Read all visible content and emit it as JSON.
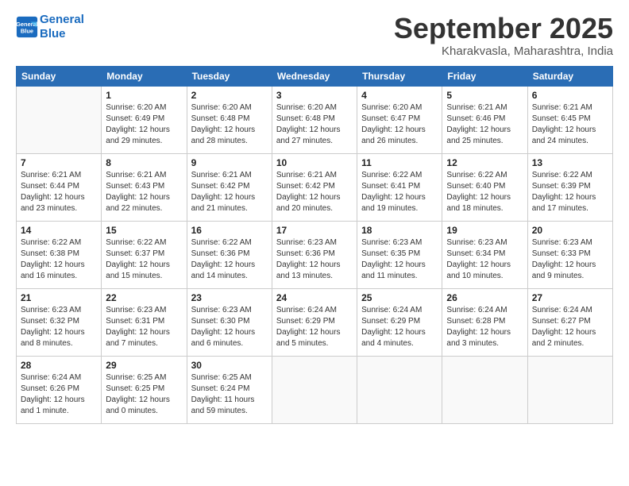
{
  "logo": {
    "line1": "General",
    "line2": "Blue"
  },
  "title": "September 2025",
  "location": "Kharakvasla, Maharashtra, India",
  "days_header": [
    "Sunday",
    "Monday",
    "Tuesday",
    "Wednesday",
    "Thursday",
    "Friday",
    "Saturday"
  ],
  "weeks": [
    [
      {
        "day": "",
        "info": ""
      },
      {
        "day": "1",
        "info": "Sunrise: 6:20 AM\nSunset: 6:49 PM\nDaylight: 12 hours\nand 29 minutes."
      },
      {
        "day": "2",
        "info": "Sunrise: 6:20 AM\nSunset: 6:48 PM\nDaylight: 12 hours\nand 28 minutes."
      },
      {
        "day": "3",
        "info": "Sunrise: 6:20 AM\nSunset: 6:48 PM\nDaylight: 12 hours\nand 27 minutes."
      },
      {
        "day": "4",
        "info": "Sunrise: 6:20 AM\nSunset: 6:47 PM\nDaylight: 12 hours\nand 26 minutes."
      },
      {
        "day": "5",
        "info": "Sunrise: 6:21 AM\nSunset: 6:46 PM\nDaylight: 12 hours\nand 25 minutes."
      },
      {
        "day": "6",
        "info": "Sunrise: 6:21 AM\nSunset: 6:45 PM\nDaylight: 12 hours\nand 24 minutes."
      }
    ],
    [
      {
        "day": "7",
        "info": "Sunrise: 6:21 AM\nSunset: 6:44 PM\nDaylight: 12 hours\nand 23 minutes."
      },
      {
        "day": "8",
        "info": "Sunrise: 6:21 AM\nSunset: 6:43 PM\nDaylight: 12 hours\nand 22 minutes."
      },
      {
        "day": "9",
        "info": "Sunrise: 6:21 AM\nSunset: 6:42 PM\nDaylight: 12 hours\nand 21 minutes."
      },
      {
        "day": "10",
        "info": "Sunrise: 6:21 AM\nSunset: 6:42 PM\nDaylight: 12 hours\nand 20 minutes."
      },
      {
        "day": "11",
        "info": "Sunrise: 6:22 AM\nSunset: 6:41 PM\nDaylight: 12 hours\nand 19 minutes."
      },
      {
        "day": "12",
        "info": "Sunrise: 6:22 AM\nSunset: 6:40 PM\nDaylight: 12 hours\nand 18 minutes."
      },
      {
        "day": "13",
        "info": "Sunrise: 6:22 AM\nSunset: 6:39 PM\nDaylight: 12 hours\nand 17 minutes."
      }
    ],
    [
      {
        "day": "14",
        "info": "Sunrise: 6:22 AM\nSunset: 6:38 PM\nDaylight: 12 hours\nand 16 minutes."
      },
      {
        "day": "15",
        "info": "Sunrise: 6:22 AM\nSunset: 6:37 PM\nDaylight: 12 hours\nand 15 minutes."
      },
      {
        "day": "16",
        "info": "Sunrise: 6:22 AM\nSunset: 6:36 PM\nDaylight: 12 hours\nand 14 minutes."
      },
      {
        "day": "17",
        "info": "Sunrise: 6:23 AM\nSunset: 6:36 PM\nDaylight: 12 hours\nand 13 minutes."
      },
      {
        "day": "18",
        "info": "Sunrise: 6:23 AM\nSunset: 6:35 PM\nDaylight: 12 hours\nand 11 minutes."
      },
      {
        "day": "19",
        "info": "Sunrise: 6:23 AM\nSunset: 6:34 PM\nDaylight: 12 hours\nand 10 minutes."
      },
      {
        "day": "20",
        "info": "Sunrise: 6:23 AM\nSunset: 6:33 PM\nDaylight: 12 hours\nand 9 minutes."
      }
    ],
    [
      {
        "day": "21",
        "info": "Sunrise: 6:23 AM\nSunset: 6:32 PM\nDaylight: 12 hours\nand 8 minutes."
      },
      {
        "day": "22",
        "info": "Sunrise: 6:23 AM\nSunset: 6:31 PM\nDaylight: 12 hours\nand 7 minutes."
      },
      {
        "day": "23",
        "info": "Sunrise: 6:23 AM\nSunset: 6:30 PM\nDaylight: 12 hours\nand 6 minutes."
      },
      {
        "day": "24",
        "info": "Sunrise: 6:24 AM\nSunset: 6:29 PM\nDaylight: 12 hours\nand 5 minutes."
      },
      {
        "day": "25",
        "info": "Sunrise: 6:24 AM\nSunset: 6:29 PM\nDaylight: 12 hours\nand 4 minutes."
      },
      {
        "day": "26",
        "info": "Sunrise: 6:24 AM\nSunset: 6:28 PM\nDaylight: 12 hours\nand 3 minutes."
      },
      {
        "day": "27",
        "info": "Sunrise: 6:24 AM\nSunset: 6:27 PM\nDaylight: 12 hours\nand 2 minutes."
      }
    ],
    [
      {
        "day": "28",
        "info": "Sunrise: 6:24 AM\nSunset: 6:26 PM\nDaylight: 12 hours\nand 1 minute."
      },
      {
        "day": "29",
        "info": "Sunrise: 6:25 AM\nSunset: 6:25 PM\nDaylight: 12 hours\nand 0 minutes."
      },
      {
        "day": "30",
        "info": "Sunrise: 6:25 AM\nSunset: 6:24 PM\nDaylight: 11 hours\nand 59 minutes."
      },
      {
        "day": "",
        "info": ""
      },
      {
        "day": "",
        "info": ""
      },
      {
        "day": "",
        "info": ""
      },
      {
        "day": "",
        "info": ""
      }
    ]
  ]
}
